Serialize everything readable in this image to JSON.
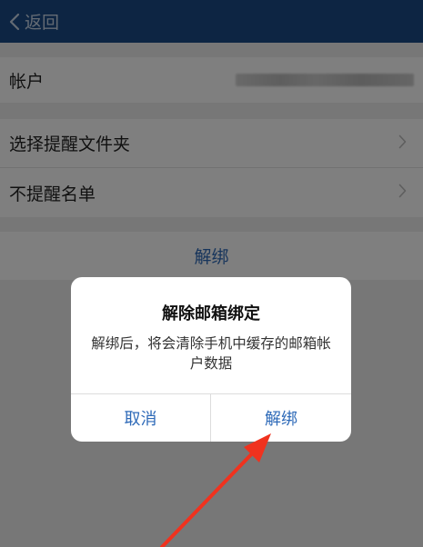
{
  "header": {
    "back_label": "返回",
    "back_icon": "chevron-left-icon",
    "background": "#1a4b86"
  },
  "rows": {
    "account_label": "帐户",
    "select_folder_label": "选择提醒文件夹",
    "no_remind_list_label": "不提醒名单",
    "unbind_label": "解绑"
  },
  "dialog": {
    "title": "解除邮箱绑定",
    "message": "解绑后，将会清除手机中缓存的邮箱帐户数据",
    "cancel_label": "取消",
    "confirm_label": "解绑"
  },
  "colors": {
    "accent": "#2e6ab8",
    "annotation_arrow": "#f0321e"
  }
}
